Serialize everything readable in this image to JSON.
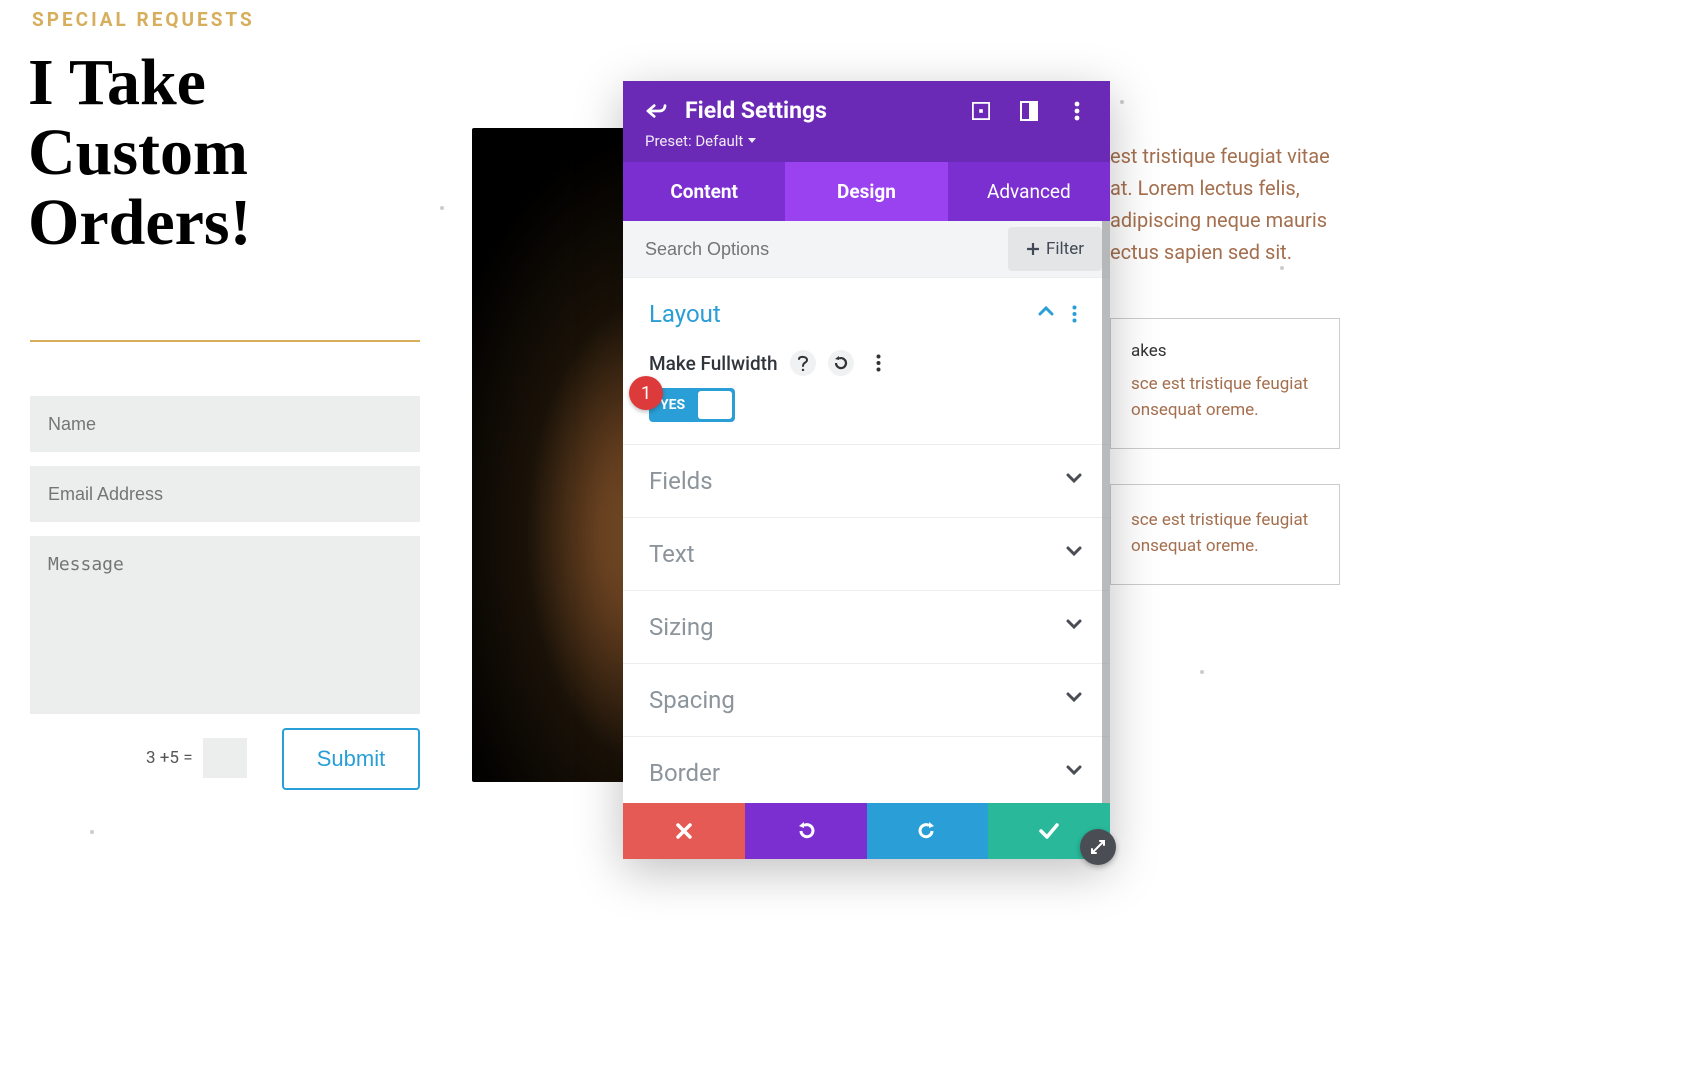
{
  "page": {
    "eyebrow": "SPECIAL REQUESTS",
    "headline": "I Take Custom Orders!",
    "form": {
      "name_placeholder": "Name",
      "email_placeholder": "Email Address",
      "message_placeholder": "Message",
      "captcha_prompt": "3 +5 =",
      "submit_label": "Submit"
    },
    "right_text": "est tristique feugiat vitae at. Lorem lectus felis, adipiscing neque mauris ectus sapien sed sit.",
    "card1": {
      "title": "akes",
      "body": "sce est tristique feugiat onsequat oreme."
    },
    "card2": {
      "body": "sce est tristique feugiat onsequat oreme."
    }
  },
  "modal": {
    "title": "Field Settings",
    "preset_label": "Preset: Default",
    "tabs": {
      "content": "Content",
      "design": "Design",
      "advanced": "Advanced"
    },
    "search_placeholder": "Search Options",
    "filter_label": "Filter",
    "sections": {
      "layout": "Layout",
      "fields": "Fields",
      "text": "Text",
      "sizing": "Sizing",
      "spacing": "Spacing",
      "border": "Border"
    },
    "layout_option": {
      "label": "Make Fullwidth",
      "toggle_value": "YES"
    },
    "badge": "1"
  }
}
